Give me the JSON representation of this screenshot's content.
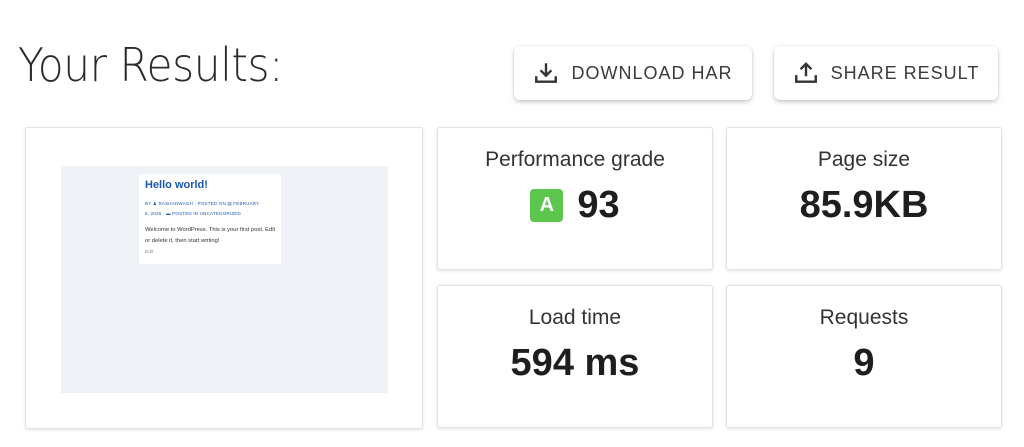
{
  "header": {
    "title": "Your Results:",
    "download_label": "DOWNLOAD HAR",
    "share_label": "SHARE RESULT"
  },
  "preview": {
    "post_title": "Hello world!",
    "meta_line1": "BY ♟ RASHADWAGH  ·  POSTED ON ▤ FEBRUARY",
    "meta_line2": "6, 2026  ·  ▬ POSTED IN UNCATEGORIZED",
    "body": "Welcome to WordPress. This is your first post. Edit or delete it, then start writing!",
    "edit": "Edit"
  },
  "metrics": {
    "performance": {
      "label": "Performance grade",
      "grade": "A",
      "score": "93"
    },
    "page_size": {
      "label": "Page size",
      "value": "85.9KB"
    },
    "load_time": {
      "label": "Load time",
      "value": "594 ms"
    },
    "requests": {
      "label": "Requests",
      "value": "9"
    }
  },
  "colors": {
    "grade_badge": "#5cc64f",
    "link_blue": "#1a57b0",
    "preview_bg": "#eef2f7"
  },
  "icons": {
    "download": "download-icon",
    "share": "share-icon"
  }
}
